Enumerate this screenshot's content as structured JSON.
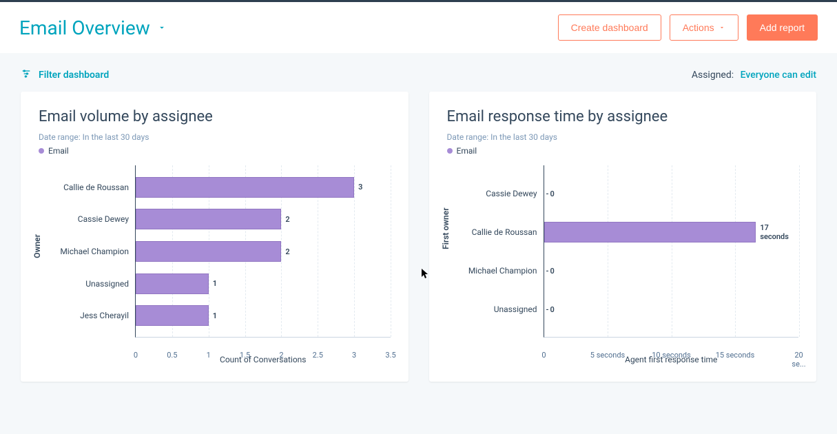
{
  "header": {
    "title": "Email Overview",
    "create_dashboard": "Create dashboard",
    "actions": "Actions",
    "add_report": "Add report"
  },
  "filter_bar": {
    "filter_label": "Filter dashboard",
    "assigned_label": "Assigned:",
    "assigned_value": "Everyone can edit"
  },
  "cards": [
    {
      "title": "Email volume by assignee",
      "date_range_label": "Date range:",
      "date_range_value": "In the last 30 days",
      "legend": "Email",
      "y_axis_label": "Owner",
      "x_axis_label": "Count of Conversations"
    },
    {
      "title": "Email response time by assignee",
      "date_range_label": "Date range:",
      "date_range_value": "In the last 30 days",
      "legend": "Email",
      "y_axis_label": "First owner",
      "x_axis_label": "Agent first response time"
    }
  ],
  "chart_data": [
    {
      "type": "bar",
      "orientation": "horizontal",
      "categories": [
        "Callie de Roussan",
        "Cassie Dewey",
        "Michael Champion",
        "Unassigned",
        "Jess Cherayil"
      ],
      "values": [
        3,
        2,
        2,
        1,
        1
      ],
      "data_labels": [
        "3",
        "2",
        "2",
        "1",
        "1"
      ],
      "series_name": "Email",
      "xlabel": "Count of Conversations",
      "ylabel": "Owner",
      "xlim": [
        0,
        3.5
      ],
      "x_ticks": [
        "0",
        "0.5",
        "1",
        "1.5",
        "2",
        "2.5",
        "3",
        "3.5"
      ],
      "bar_color": "#a78cd6"
    },
    {
      "type": "bar",
      "orientation": "horizontal",
      "categories": [
        "Cassie Dewey",
        "Callie de Roussan",
        "Michael Champion",
        "Unassigned"
      ],
      "values": [
        0,
        17,
        0,
        0
      ],
      "data_labels": [
        "0",
        "17 seconds",
        "0",
        "0"
      ],
      "series_name": "Email",
      "xlabel": "Agent first response time",
      "ylabel": "First owner",
      "xlim": [
        0,
        20
      ],
      "x_ticks": [
        "0",
        "5 seconds",
        "10 seconds",
        "15 seconds",
        "20 se..."
      ],
      "bar_color": "#a78cd6"
    }
  ]
}
